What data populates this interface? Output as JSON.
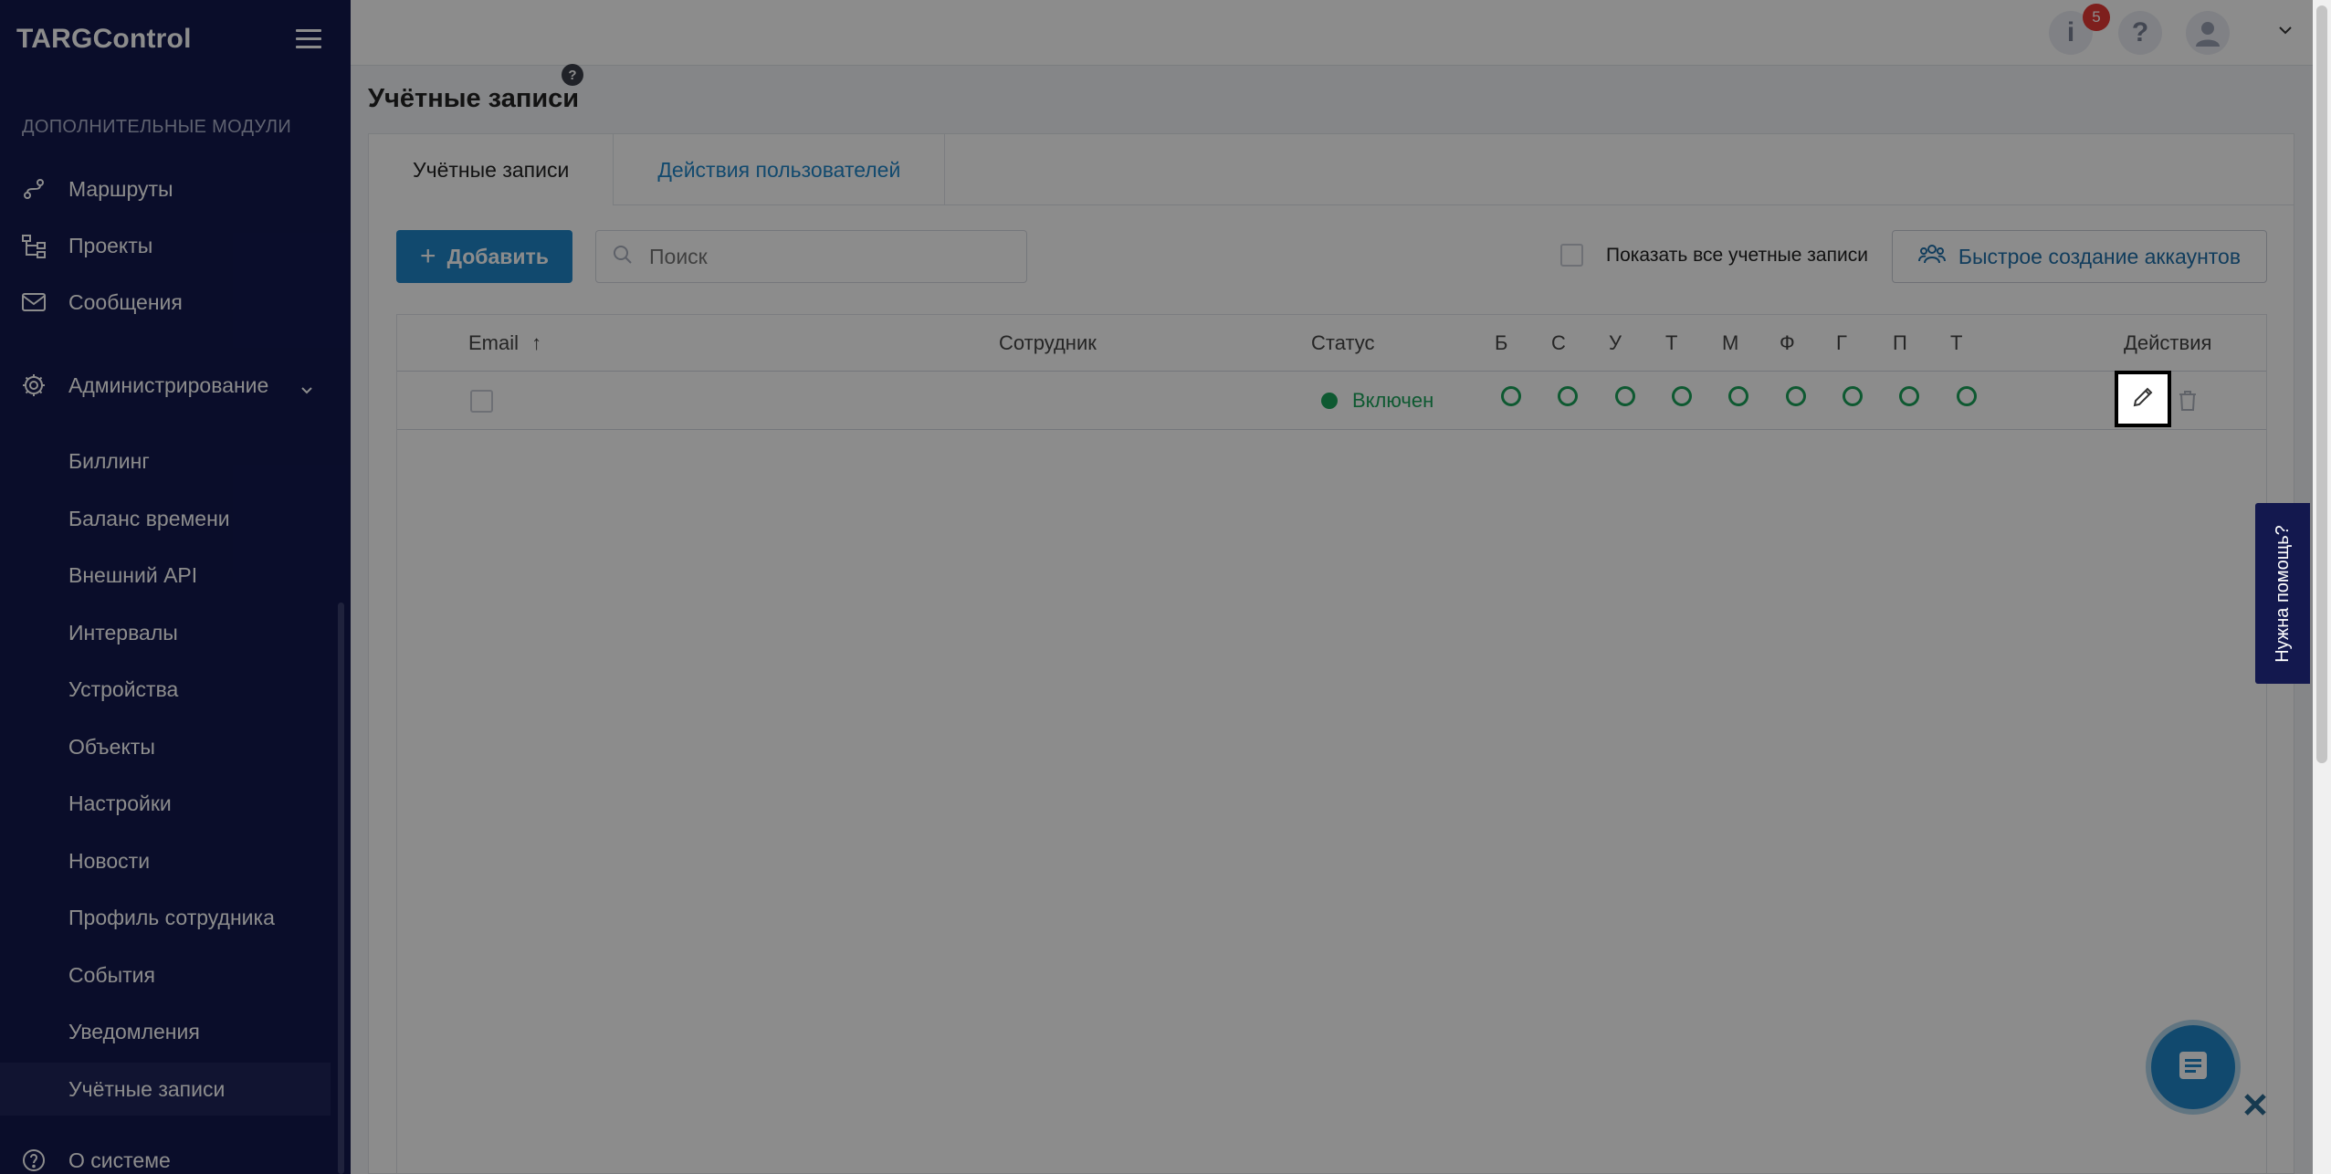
{
  "sidebar": {
    "logo": "TARGControl",
    "section_label": "Дополнительные модули",
    "modules": [
      {
        "label": "Маршруты",
        "icon": "route-icon"
      },
      {
        "label": "Проекты",
        "icon": "project-tree-icon"
      },
      {
        "label": "Сообщения",
        "icon": "mail-icon"
      }
    ],
    "admin": {
      "label": "Администрирование",
      "icon": "gear-icon"
    },
    "sub_items": [
      {
        "label": "Биллинг"
      },
      {
        "label": "Баланс времени"
      },
      {
        "label": "Внешний API"
      },
      {
        "label": "Интервалы"
      },
      {
        "label": "Устройства"
      },
      {
        "label": "Объекты"
      },
      {
        "label": "Настройки"
      },
      {
        "label": "Новости"
      },
      {
        "label": "Профиль сотрудника"
      },
      {
        "label": "События"
      },
      {
        "label": "Уведомления"
      },
      {
        "label": "Учётные записи",
        "active": true
      }
    ],
    "about": {
      "label": "О системе",
      "icon": "question-circle-icon"
    }
  },
  "header": {
    "notifications_count": "5",
    "info_glyph": "i",
    "help_glyph": "?"
  },
  "page": {
    "title": "Учётные записи",
    "help_glyph": "?",
    "tabs": [
      {
        "label": "Учётные записи",
        "active": true
      },
      {
        "label": "Действия пользователей",
        "active": false
      }
    ],
    "toolbar": {
      "add_label": "Добавить",
      "add_glyph": "+",
      "search_placeholder": "Поиск",
      "show_all_label": "Показать все учетные записи",
      "quick_create_label": "Быстрое создание аккаунтов"
    },
    "table": {
      "columns": {
        "email": "Email",
        "sort_glyph": "↑",
        "employee": "Сотрудник",
        "status": "Статус",
        "actions": "Действия",
        "flags": [
          "Б",
          "С",
          "У",
          "Т",
          "М",
          "Ф",
          "Г",
          "П",
          "Т"
        ]
      },
      "rows": [
        {
          "email": "",
          "employee": "",
          "status": "Включен",
          "flags_on": [
            true,
            true,
            true,
            true,
            true,
            true,
            true,
            true,
            true
          ]
        }
      ]
    }
  },
  "help_widget": {
    "label": "Нужна помощь?"
  },
  "colors": {
    "sidebar_bg": "#13184e",
    "accent": "#1f86c9",
    "status_green": "#1aa35a",
    "badge_red": "#e53935"
  }
}
